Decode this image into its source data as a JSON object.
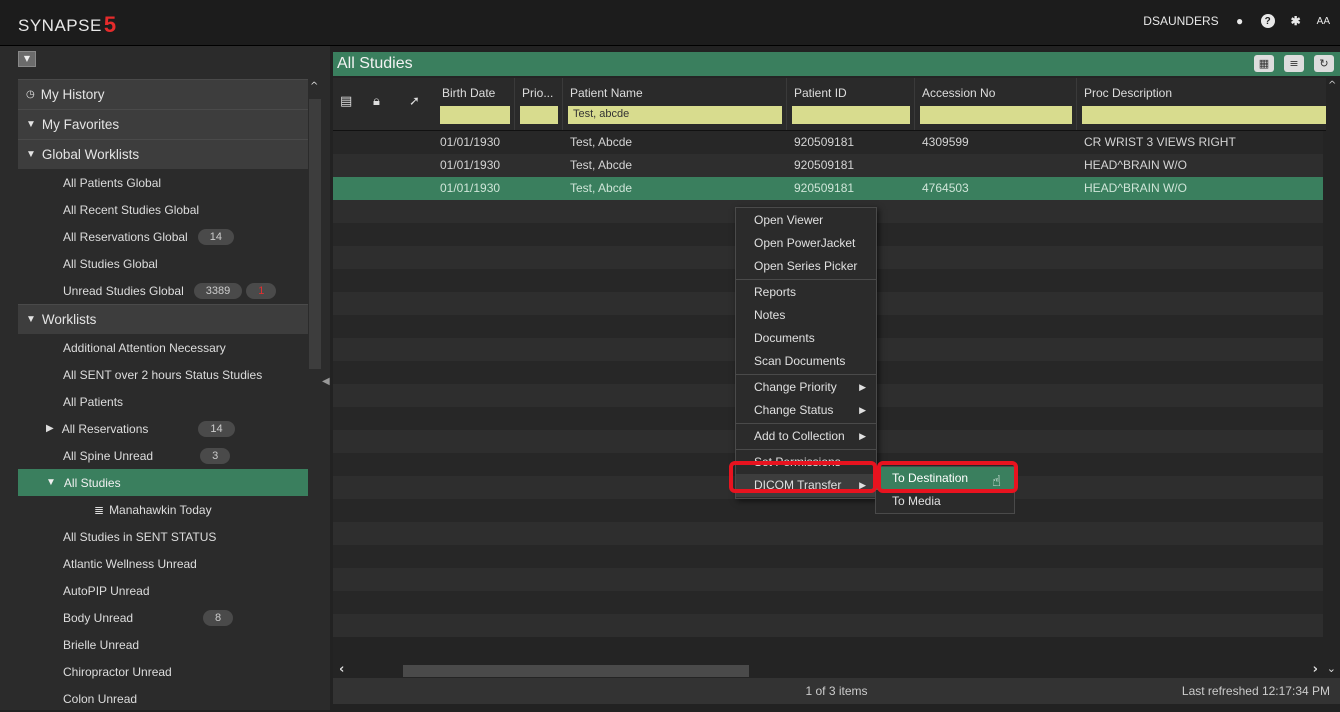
{
  "app": {
    "logo_text": "SYNAPSE",
    "logo_mark": "5"
  },
  "topbar": {
    "username": "DSAUNDERS",
    "font_size_label": "AA"
  },
  "sidebar": {
    "sections": [
      {
        "label": "My History"
      },
      {
        "label": "My Favorites"
      },
      {
        "label": "Global Worklists"
      }
    ],
    "global_items": [
      {
        "label": "All Patients Global"
      },
      {
        "label": "All Recent Studies Global"
      },
      {
        "label": "All Reservations Global",
        "badge": "14"
      },
      {
        "label": "All Studies Global"
      },
      {
        "label": "Unread Studies Global",
        "badge": "3389",
        "badge2": "1"
      }
    ],
    "worklists_label": "Worklists",
    "worklist_items": [
      {
        "label": "Additional Attention Necessary"
      },
      {
        "label": "All  SENT over 2 hours Status Studies"
      },
      {
        "label": "All Patients"
      },
      {
        "label": "All Reservations",
        "badge": "14"
      },
      {
        "label": "All Spine Unread",
        "badge": "3"
      },
      {
        "label": "All Studies"
      },
      {
        "label": "Manahawkin Today"
      },
      {
        "label": "All Studies in SENT STATUS"
      },
      {
        "label": "Atlantic Wellness Unread"
      },
      {
        "label": "AutoPIP Unread"
      },
      {
        "label": "Body Unread",
        "badge": "8"
      },
      {
        "label": "Brielle Unread"
      },
      {
        "label": "Chiropractor Unread"
      },
      {
        "label": "Colon Unread"
      }
    ]
  },
  "main": {
    "title": "All Studies",
    "columns": {
      "birth_date": "Birth Date",
      "priority": "Prio...",
      "patient_name": "Patient Name",
      "patient_id": "Patient ID",
      "accession_no": "Accession No",
      "proc_description": "Proc Description"
    },
    "filters": {
      "patient_name": "Test, abcde"
    },
    "rows": [
      {
        "birth_date": "01/01/1930",
        "patient_name": "Test, Abcde",
        "patient_id": "920509181",
        "accession_no": "4309599",
        "proc_description": "CR WRIST 3 VIEWS RIGHT"
      },
      {
        "birth_date": "01/01/1930",
        "patient_name": "Test, Abcde",
        "patient_id": "920509181",
        "accession_no": "",
        "proc_description": "HEAD^BRAIN W/O"
      },
      {
        "birth_date": "01/01/1930",
        "patient_name": "Test, Abcde",
        "patient_id": "920509181",
        "accession_no": "4764503",
        "proc_description": "HEAD^BRAIN W/O"
      }
    ],
    "selected_row": 2,
    "status": {
      "count": "1 of 3 items",
      "last_refreshed": "Last refreshed 12:17:34 PM"
    }
  },
  "context_menu": {
    "groups": [
      [
        "Open Viewer",
        "Open PowerJacket",
        "Open Series Picker"
      ],
      [
        "Reports",
        "Notes",
        "Documents",
        "Scan Documents"
      ],
      [
        "Change Priority",
        "Change Status"
      ],
      [
        "Add to Collection"
      ],
      [
        "Set Permissions",
        "DICOM Transfer"
      ]
    ],
    "submenu": [
      "To Destination",
      "To Media"
    ]
  },
  "colors": {
    "accent_green": "#3a7f5e",
    "filter_yellow": "#d8dc8e",
    "highlight_red": "#e8131f"
  }
}
